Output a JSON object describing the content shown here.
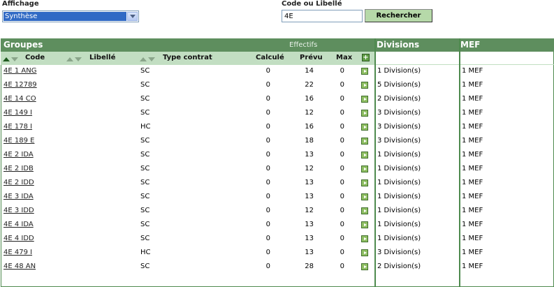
{
  "filters": {
    "affichage_label": "Affichage",
    "affichage_value": "Synthèse",
    "search_label": "Code ou Libellé",
    "search_value": "4E",
    "search_button": "Rechercher"
  },
  "table": {
    "groupes_title": "Groupes",
    "effectifs_label": "Effectifs",
    "divisions_title": "Divisions",
    "mef_title": "MEF",
    "col_code": "Code",
    "col_libelle": "Libellé",
    "col_type": "Type contrat",
    "col_calc": "Calculé",
    "col_prevu": "Prévu",
    "col_max": "Max",
    "plus_label": "+",
    "rows": [
      {
        "code": "4E 1 ANG",
        "type": "SC",
        "calc": "0",
        "prevu": "14",
        "max": "0",
        "divisions": "1 Division(s)",
        "mef": "1 MEF"
      },
      {
        "code": "4E 12789",
        "type": "SC",
        "calc": "0",
        "prevu": "22",
        "max": "0",
        "divisions": "5 Division(s)",
        "mef": "1 MEF"
      },
      {
        "code": "4E 14 CO",
        "type": "SC",
        "calc": "0",
        "prevu": "16",
        "max": "0",
        "divisions": "2 Division(s)",
        "mef": "1 MEF"
      },
      {
        "code": "4E 149 I",
        "type": "SC",
        "calc": "0",
        "prevu": "12",
        "max": "0",
        "divisions": "3 Division(s)",
        "mef": "1 MEF"
      },
      {
        "code": "4E 178 I",
        "type": "HC",
        "calc": "0",
        "prevu": "16",
        "max": "0",
        "divisions": "3 Division(s)",
        "mef": "1 MEF"
      },
      {
        "code": "4E 189 E",
        "type": "SC",
        "calc": "0",
        "prevu": "18",
        "max": "0",
        "divisions": "3 Division(s)",
        "mef": "1 MEF"
      },
      {
        "code": "4E 2 IDA",
        "type": "SC",
        "calc": "0",
        "prevu": "13",
        "max": "0",
        "divisions": "1 Division(s)",
        "mef": "1 MEF"
      },
      {
        "code": "4E 2 IDB",
        "type": "SC",
        "calc": "0",
        "prevu": "12",
        "max": "0",
        "divisions": "1 Division(s)",
        "mef": "1 MEF"
      },
      {
        "code": "4E 2 IDD",
        "type": "SC",
        "calc": "0",
        "prevu": "13",
        "max": "0",
        "divisions": "1 Division(s)",
        "mef": "1 MEF"
      },
      {
        "code": "4E 3 IDA",
        "type": "SC",
        "calc": "0",
        "prevu": "13",
        "max": "0",
        "divisions": "1 Division(s)",
        "mef": "1 MEF"
      },
      {
        "code": "4E 3 IDD",
        "type": "SC",
        "calc": "0",
        "prevu": "12",
        "max": "0",
        "divisions": "1 Division(s)",
        "mef": "1 MEF"
      },
      {
        "code": "4E 4 IDA",
        "type": "SC",
        "calc": "0",
        "prevu": "13",
        "max": "0",
        "divisions": "1 Division(s)",
        "mef": "1 MEF"
      },
      {
        "code": "4E 4 IDD",
        "type": "SC",
        "calc": "0",
        "prevu": "13",
        "max": "0",
        "divisions": "1 Division(s)",
        "mef": "1 MEF"
      },
      {
        "code": "4E 479 I",
        "type": "HC",
        "calc": "0",
        "prevu": "13",
        "max": "0",
        "divisions": "3 Division(s)",
        "mef": "1 MEF"
      },
      {
        "code": "4E 48 AN",
        "type": "SC",
        "calc": "0",
        "prevu": "28",
        "max": "0",
        "divisions": "2 Division(s)",
        "mef": "1 MEF"
      }
    ]
  }
}
